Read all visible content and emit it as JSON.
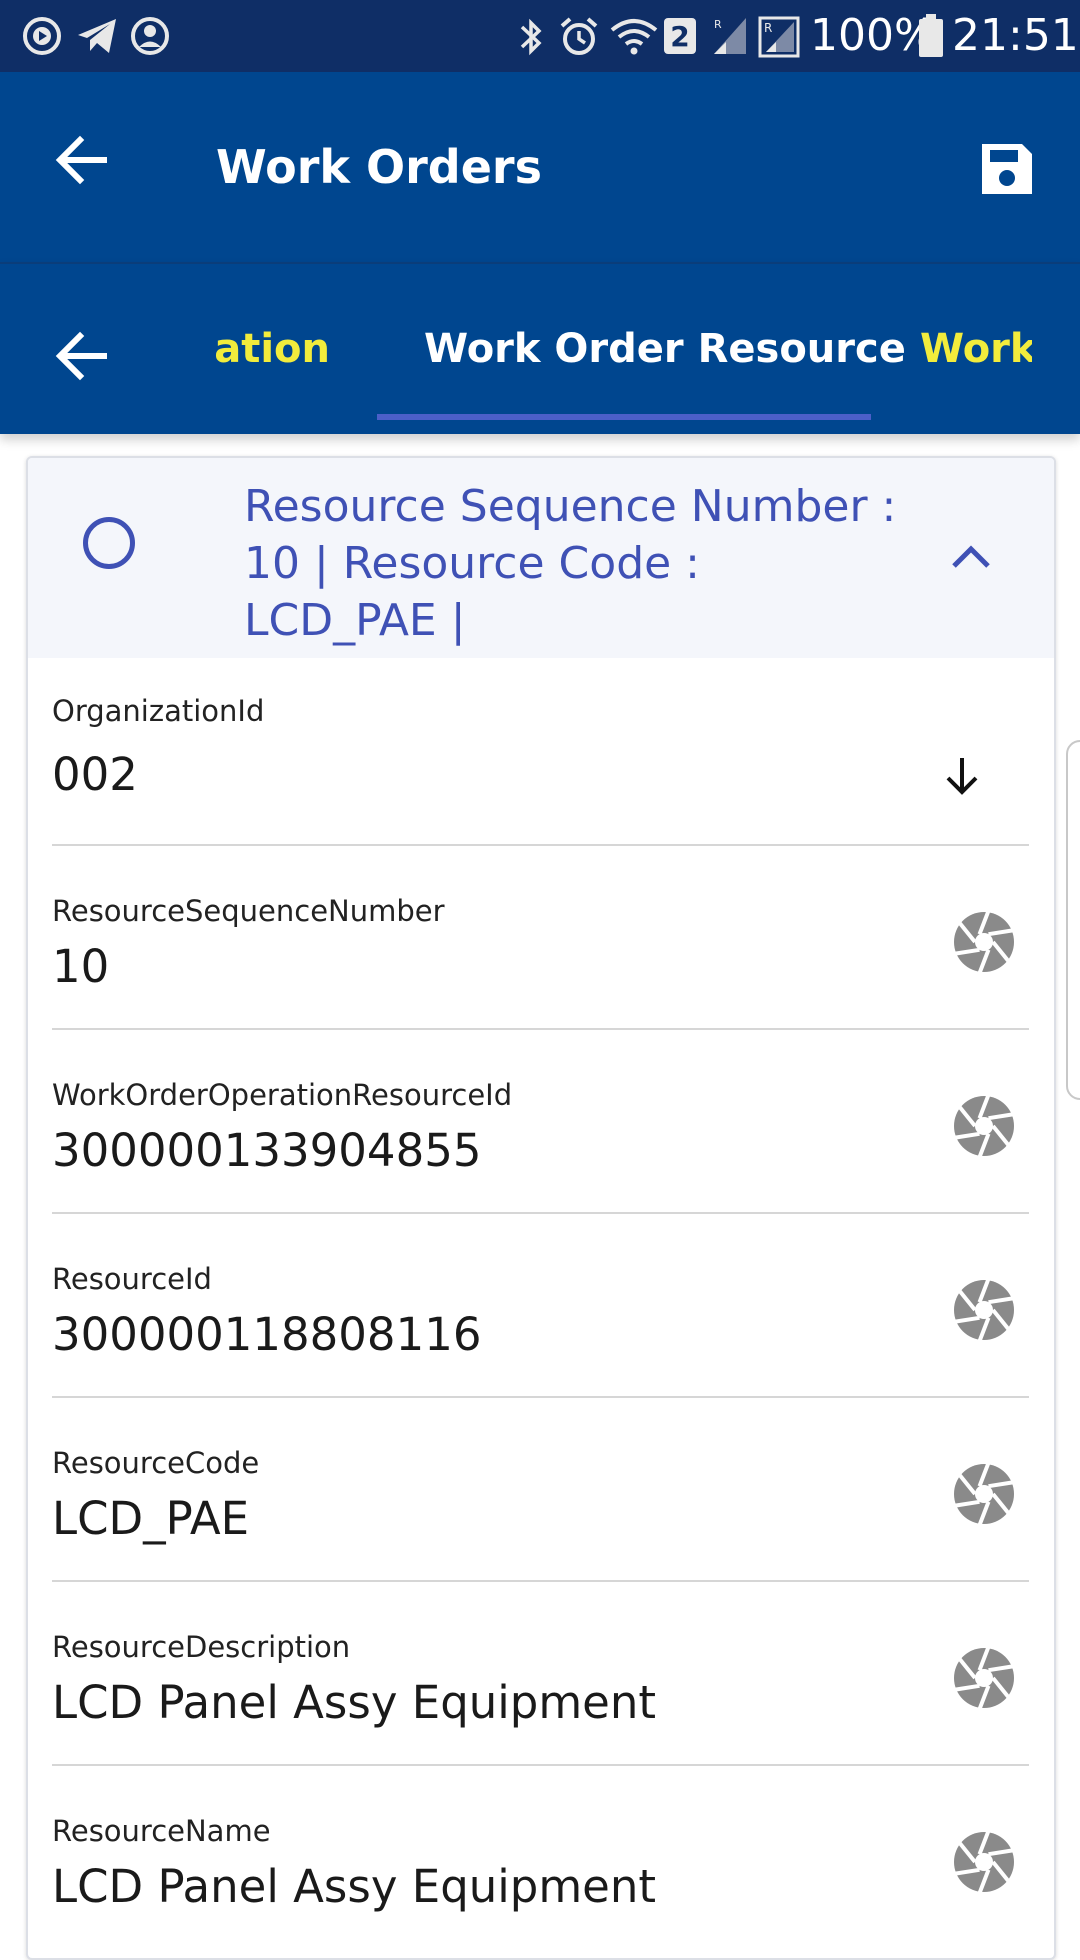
{
  "status_bar": {
    "battery_percent": "100%",
    "time": "21:51",
    "sim_badge": "2",
    "left_icons": [
      "play-circle-icon",
      "telegram-icon",
      "account-circle-icon"
    ],
    "right_icons": [
      "bluetooth-icon",
      "alarm-icon",
      "wifi-icon",
      "signal-icon",
      "signal-roaming-icon",
      "battery-icon"
    ]
  },
  "app_bar": {
    "title": "Work Orders",
    "back_icon": "arrow-back-icon",
    "save_icon": "save-icon"
  },
  "tabs": {
    "back_icon": "arrow-back-icon",
    "items": [
      {
        "label": "vation",
        "active": false
      },
      {
        "label": "Work Order Resource",
        "active": true
      },
      {
        "label": "Work (",
        "active": false
      }
    ],
    "accent_color": "#f2ec3c",
    "underline_color": "#4b5fc9"
  },
  "card": {
    "title_line1": "Resource Sequence Number :",
    "title_line2": "10 | Resource Code :",
    "title_line3": "LCD_PAE |",
    "expanded": true
  },
  "fields": [
    {
      "label": "OrganizationId",
      "value": "002",
      "icon": "arrow-down-icon"
    },
    {
      "label": "ResourceSequenceNumber",
      "value": "10",
      "icon": "camera-aperture-icon"
    },
    {
      "label": "WorkOrderOperationResourceId",
      "value": "300000133904855",
      "icon": "camera-aperture-icon"
    },
    {
      "label": "ResourceId",
      "value": "300000118808116",
      "icon": "camera-aperture-icon"
    },
    {
      "label": "ResourceCode",
      "value": "LCD_PAE",
      "icon": "camera-aperture-icon"
    },
    {
      "label": "ResourceDescription",
      "value": "LCD Panel Assy Equipment",
      "icon": "camera-aperture-icon"
    },
    {
      "label": "ResourceName",
      "value": "LCD Panel Assy Equipment",
      "icon": "camera-aperture-icon"
    }
  ],
  "colors": {
    "status_bar": "#0f2e66",
    "app_bar": "#00468f",
    "primary_indigo": "#3f51b5",
    "icon_gray": "#8a8a8a"
  }
}
